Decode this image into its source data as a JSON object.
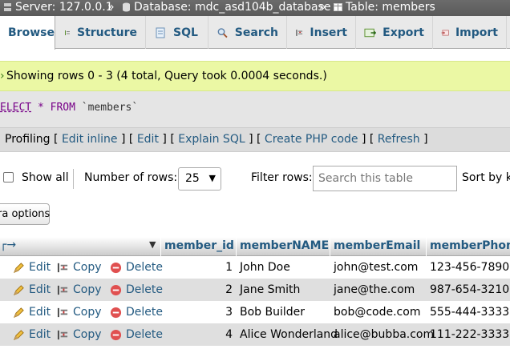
{
  "breadcrumb": {
    "server": "Server: 127.0.0.1",
    "database": "Database: mdc_asd104b_database",
    "table": "Table: members",
    "separator": "»"
  },
  "tabs": [
    {
      "label": "Browse",
      "icon": "browse-icon",
      "active": true
    },
    {
      "label": "Structure",
      "icon": "structure-icon"
    },
    {
      "label": "SQL",
      "icon": "sql-icon"
    },
    {
      "label": "Search",
      "icon": "search-icon"
    },
    {
      "label": "Insert",
      "icon": "insert-icon"
    },
    {
      "label": "Export",
      "icon": "export-icon"
    },
    {
      "label": "Import",
      "icon": "import-icon"
    }
  ],
  "message": "Showing rows 0 - 3 (4 total, Query took 0.0004 seconds.)",
  "sql": {
    "keyword": "ELECT",
    "star": "*",
    "from": "FROM",
    "table": "`members`"
  },
  "links": {
    "profiling": "Profiling",
    "edit_inline": "Edit inline",
    "edit": "Edit",
    "explain": "Explain SQL",
    "create_php": "Create PHP code",
    "refresh": "Refresh"
  },
  "nav": {
    "show_all": "Show all",
    "num_rows_label": "Number of rows:",
    "num_rows_value": "25",
    "filter_label": "Filter rows:",
    "search_placeholder": "Search this table",
    "sort_label": "Sort by ke"
  },
  "extra_options": "ra options",
  "columns": [
    "member_id",
    "memberNAME",
    "memberEmail",
    "memberPhone"
  ],
  "actions": {
    "edit": "Edit",
    "copy": "Copy",
    "delete": "Delete"
  },
  "rows": [
    {
      "id": "1",
      "name": "John Doe",
      "email": "john@test.com",
      "phone": "123-456-7890"
    },
    {
      "id": "2",
      "name": "Jane Smith",
      "email": "jane@the.com",
      "phone": "987-654-3210"
    },
    {
      "id": "3",
      "name": "Bob Builder",
      "email": "bob@code.com",
      "phone": "555-444-3333"
    },
    {
      "id": "4",
      "name": "Alice Wonderland",
      "email": "alice@bubba.com",
      "phone": "111-222-3333"
    }
  ],
  "colors": {
    "link": "#235a81",
    "success_bg": "#ebf8a4",
    "tab_bg": "#e9e9e9"
  }
}
